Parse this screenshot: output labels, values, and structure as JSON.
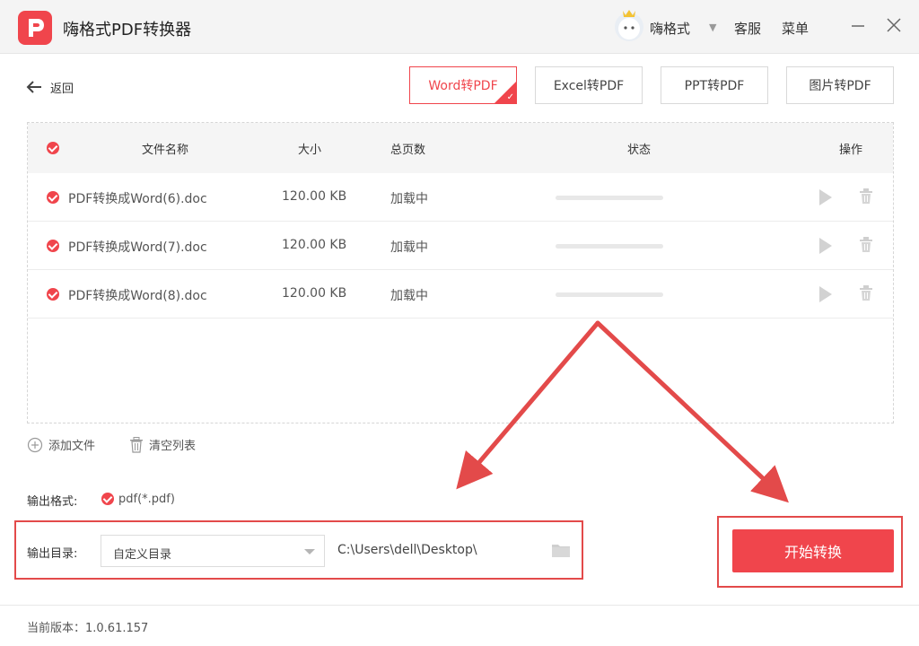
{
  "app": {
    "title": "嗨格式PDF转换器"
  },
  "user": {
    "name": "嗨格式"
  },
  "header_menu": {
    "service": "客服",
    "menu": "菜单"
  },
  "nav": {
    "back": "返回"
  },
  "tabs": [
    {
      "label": "Word转PDF",
      "active": true
    },
    {
      "label": "Excel转PDF",
      "active": false
    },
    {
      "label": "PPT转PDF",
      "active": false
    },
    {
      "label": "图片转PDF",
      "active": false
    }
  ],
  "table": {
    "columns": {
      "name": "文件名称",
      "size": "大小",
      "pages": "总页数",
      "status": "状态",
      "actions": "操作"
    },
    "rows": [
      {
        "name": "PDF转换成Word(6).doc",
        "size": "120.00 KB",
        "pages": "加载中",
        "progress": 0
      },
      {
        "name": "PDF转换成Word(7).doc",
        "size": "120.00 KB",
        "pages": "加载中",
        "progress": 0
      },
      {
        "name": "PDF转换成Word(8).doc",
        "size": "120.00 KB",
        "pages": "加载中",
        "progress": 0
      }
    ]
  },
  "file_actions": {
    "add": "添加文件",
    "clear": "清空列表"
  },
  "output": {
    "format_label": "输出格式:",
    "format_value": "pdf(*.pdf)",
    "dir_label": "输出目录:",
    "dir_option": "自定义目录",
    "dir_path": "C:\\Users\\dell\\Desktop\\"
  },
  "start_button": "开始转换",
  "footer": {
    "version": "当前版本：1.0.61.157"
  },
  "colors": {
    "accent": "#f0454c",
    "annotation": "#e34a4a"
  },
  "icons": [
    "back-arrow-icon",
    "play-icon",
    "trash-icon",
    "plus-circle-icon",
    "folder-icon",
    "minimize-icon",
    "close-icon",
    "chevron-down-icon"
  ]
}
